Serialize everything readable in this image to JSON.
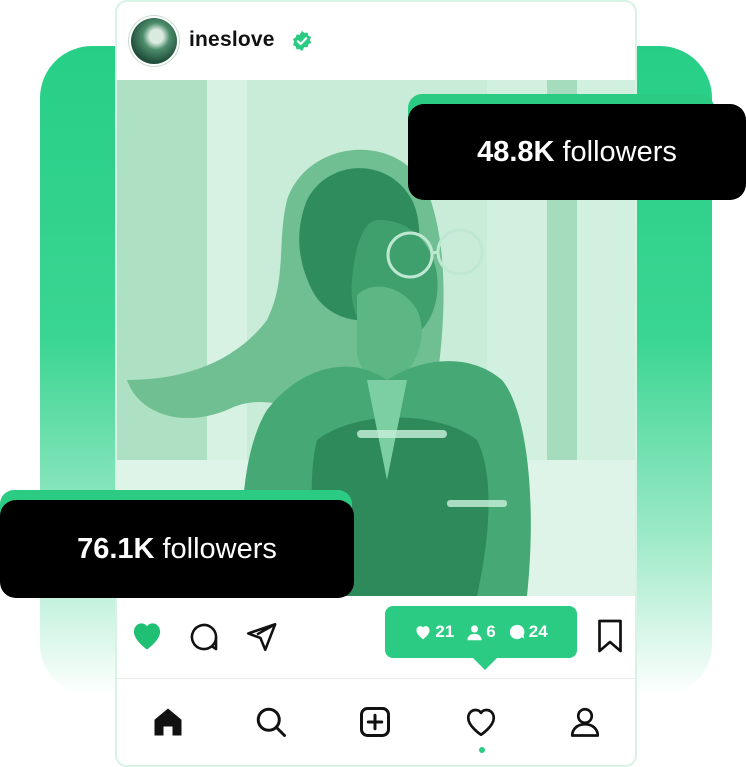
{
  "post": {
    "username": "ineslove",
    "verified": true
  },
  "badges": {
    "top": {
      "count": "48.8K",
      "label": "followers"
    },
    "bottom": {
      "count": "76.1K",
      "label": "followers"
    }
  },
  "notification": {
    "likes": "21",
    "follows": "6",
    "comments": "24"
  },
  "actions": [
    "heart-icon",
    "comment-icon",
    "share-icon",
    "bookmark-icon"
  ],
  "nav": [
    "home-icon",
    "search-icon",
    "add-icon",
    "activity-icon",
    "profile-icon"
  ],
  "colors": {
    "accent": "#2ccb84",
    "dark": "#000000"
  }
}
